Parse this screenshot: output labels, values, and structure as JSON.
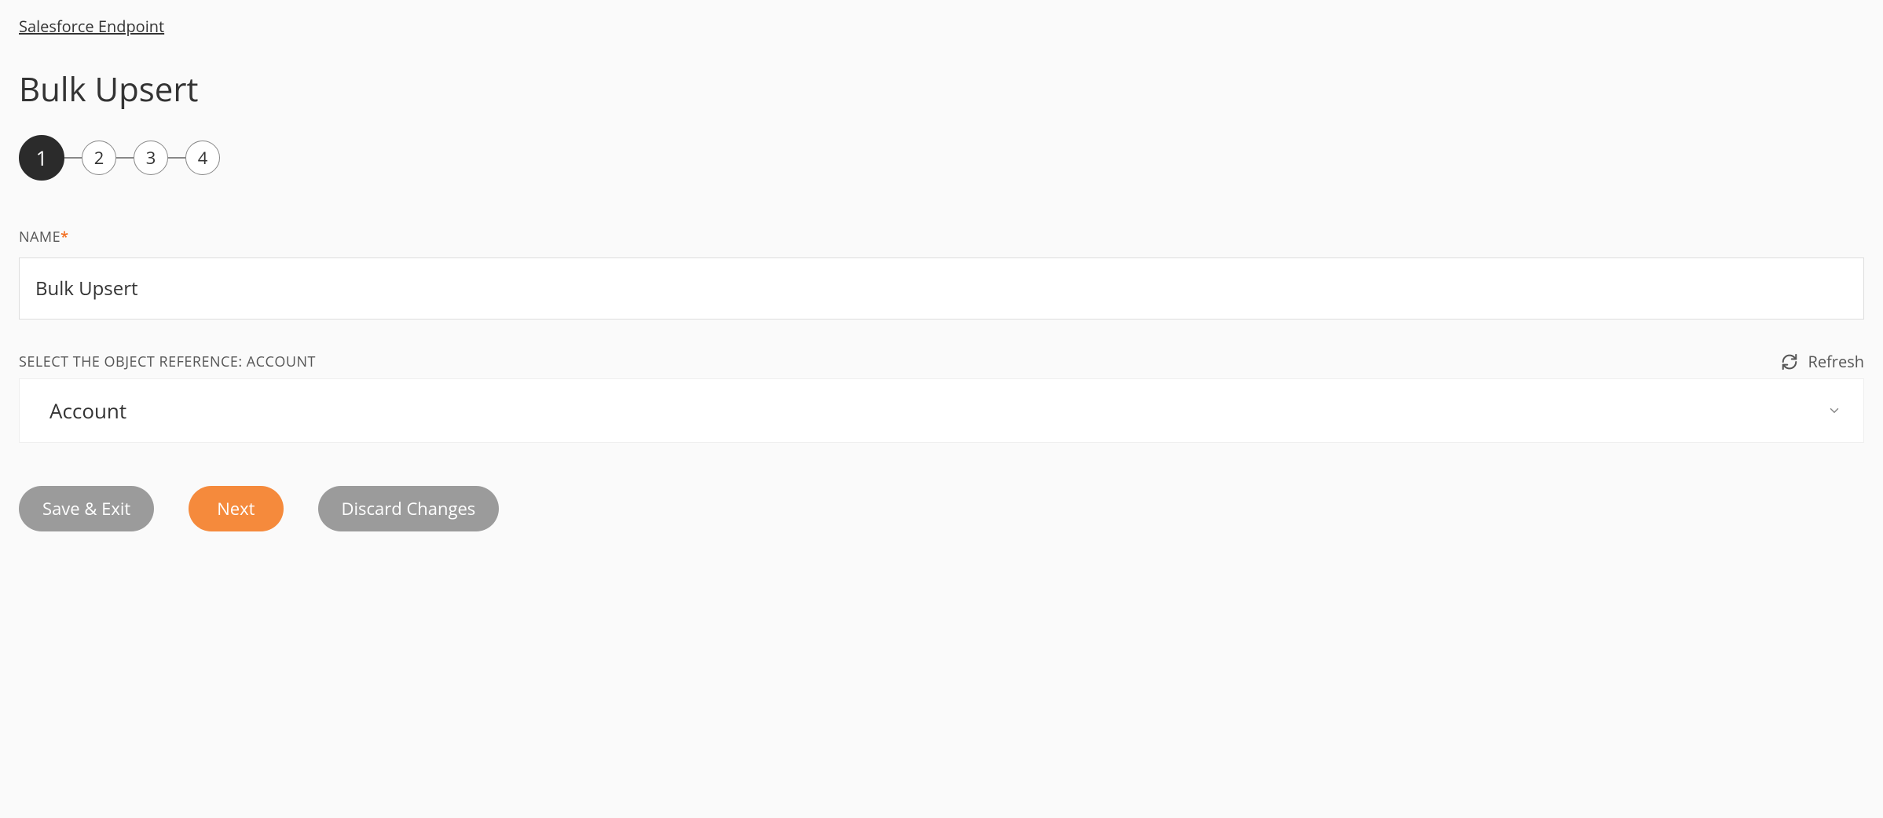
{
  "breadcrumb": "Salesforce Endpoint",
  "title": "Bulk Upsert",
  "stepper": {
    "steps": [
      "1",
      "2",
      "3",
      "4"
    ],
    "active_index": 0
  },
  "fields": {
    "name": {
      "label": "NAME",
      "required_mark": "*",
      "value": "Bulk Upsert"
    },
    "object_reference": {
      "label": "SELECT THE OBJECT REFERENCE: ACCOUNT",
      "refresh_label": "Refresh",
      "selected": "Account"
    }
  },
  "buttons": {
    "save_exit": "Save & Exit",
    "next": "Next",
    "discard": "Discard Changes"
  }
}
